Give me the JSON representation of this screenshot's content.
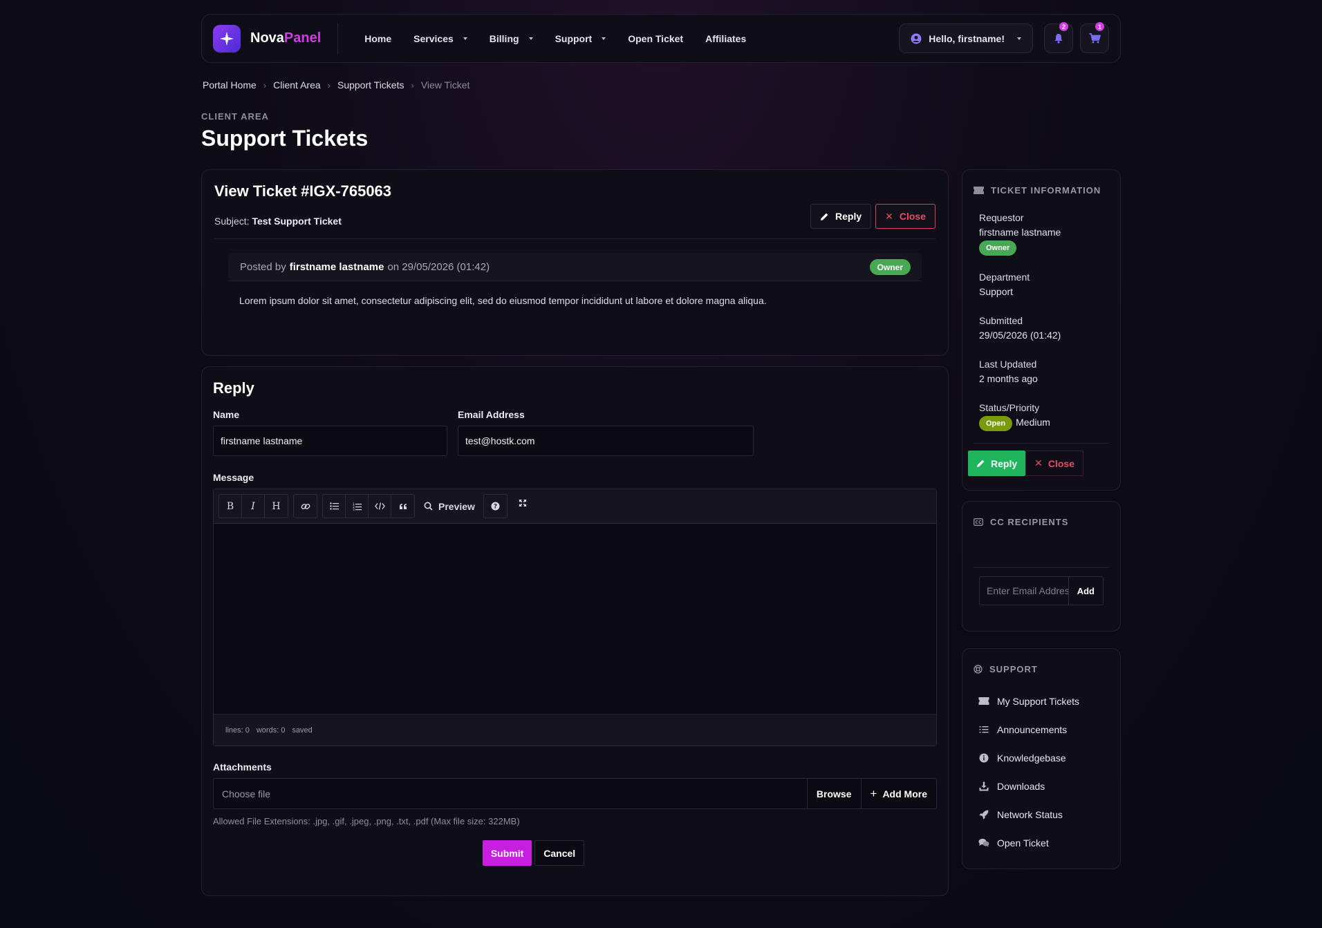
{
  "brand": {
    "name_part1": "Nova",
    "name_part2": "Panel",
    "accent": "#d23ce6"
  },
  "nav": {
    "items": [
      {
        "label": "Home",
        "dropdown": false
      },
      {
        "label": "Services",
        "dropdown": true
      },
      {
        "label": "Billing",
        "dropdown": true
      },
      {
        "label": "Support",
        "dropdown": true
      },
      {
        "label": "Open Ticket",
        "dropdown": false
      },
      {
        "label": "Affiliates",
        "dropdown": false
      }
    ],
    "greeting": "Hello, firstname!",
    "notifications_count": "2",
    "cart_count": "1"
  },
  "breadcrumb": [
    "Portal Home",
    "Client Area",
    "Support Tickets",
    "View Ticket"
  ],
  "page": {
    "eyebrow": "CLIENT AREA",
    "title": "Support Tickets"
  },
  "ticket": {
    "title": "View Ticket #IGX-765063",
    "subject_label": "Subject:",
    "subject": "Test Support Ticket",
    "reply_label": "Reply",
    "close_label": "Close",
    "post": {
      "posted_by_label": "Posted by",
      "author": "firstname lastname",
      "on_label": "on 29/05/2026 (01:42)",
      "role_badge": "Owner",
      "body": "Lorem ipsum dolor sit amet, consectetur adipiscing elit, sed do eiusmod tempor incididunt ut labore et dolore magna aliqua."
    }
  },
  "reply_form": {
    "title": "Reply",
    "name_label": "Name",
    "name_value": "firstname lastname",
    "email_label": "Email Address",
    "email_value": "test@hostk.com",
    "message_label": "Message",
    "preview_label": "Preview",
    "status": {
      "lines": "lines: 0",
      "words": "words: 0",
      "saved": "saved"
    },
    "attachments_label": "Attachments",
    "file_placeholder": "Choose file",
    "browse_label": "Browse",
    "add_more_label": "Add More",
    "allowed_text": "Allowed File Extensions: .jpg, .gif, .jpeg, .png, .txt, .pdf (Max file size: 322MB)",
    "submit_label": "Submit",
    "cancel_label": "Cancel"
  },
  "sidebar": {
    "info_title": "TICKET INFORMATION",
    "requestor_label": "Requestor",
    "requestor_value": "firstname lastname",
    "requestor_badge": "Owner",
    "department_label": "Department",
    "department_value": "Support",
    "submitted_label": "Submitted",
    "submitted_value": "29/05/2026 (01:42)",
    "updated_label": "Last Updated",
    "updated_value": "2 months ago",
    "status_label": "Status/Priority",
    "status_badge": "Open",
    "priority_value": "Medium",
    "reply_label": "Reply",
    "close_label": "Close",
    "cc_title": "CC RECIPIENTS",
    "cc_placeholder": "Enter Email Address",
    "cc_add_label": "Add",
    "support_title": "SUPPORT",
    "support_links": [
      {
        "label": "My Support Tickets",
        "icon": "ticket-icon"
      },
      {
        "label": "Announcements",
        "icon": "list-icon"
      },
      {
        "label": "Knowledgebase",
        "icon": "info-icon"
      },
      {
        "label": "Downloads",
        "icon": "download-icon"
      },
      {
        "label": "Network Status",
        "icon": "rocket-icon"
      },
      {
        "label": "Open Ticket",
        "icon": "comments-icon"
      }
    ]
  }
}
